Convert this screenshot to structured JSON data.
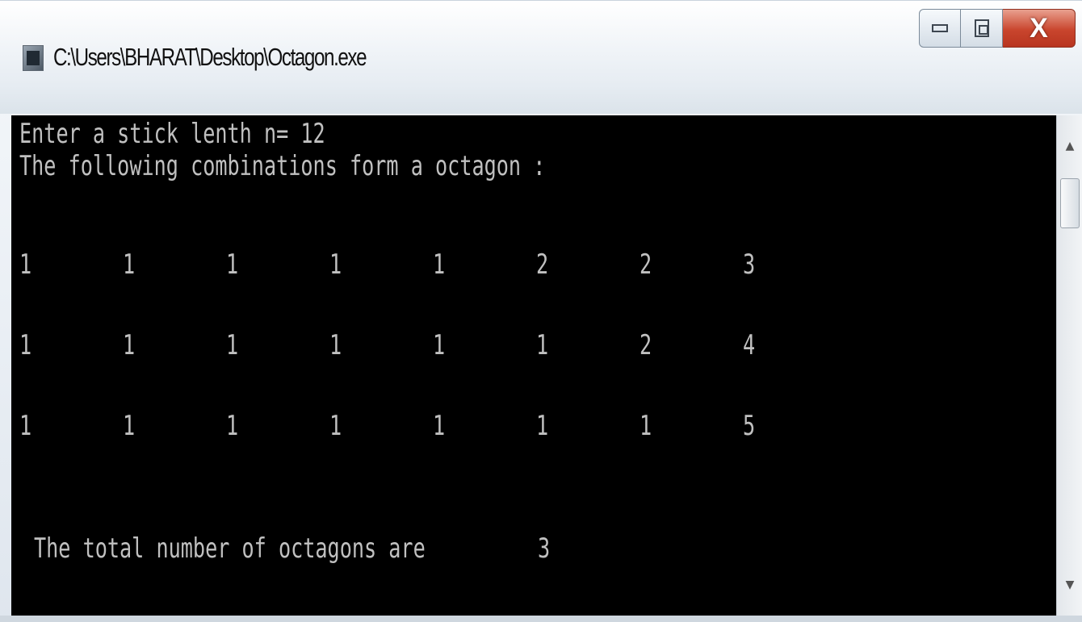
{
  "window": {
    "title": "C:\\Users\\BHARAT\\Desktop\\Octagon.exe",
    "icon": "console-app-icon",
    "controls": {
      "minimize": "minimize-icon",
      "maximize": "maximize-icon",
      "close": "X"
    }
  },
  "console": {
    "prompt_line": "Enter a stick lenth n= 12",
    "header_line": "The following combinations form a octagon :",
    "combinations": [
      [
        "1",
        "1",
        "1",
        "1",
        "1",
        "2",
        "2",
        "3"
      ],
      [
        "1",
        "1",
        "1",
        "1",
        "1",
        "1",
        "2",
        "4"
      ],
      [
        "1",
        "1",
        "1",
        "1",
        "1",
        "1",
        "1",
        "5"
      ]
    ],
    "total_label": "The total number of octagons are",
    "total_value": "3",
    "colors": {
      "background": "#000000",
      "text": "#c0c0c0"
    }
  },
  "scrollbar": {
    "up": "scroll-up-arrow-icon",
    "down": "scroll-down-arrow-icon"
  }
}
